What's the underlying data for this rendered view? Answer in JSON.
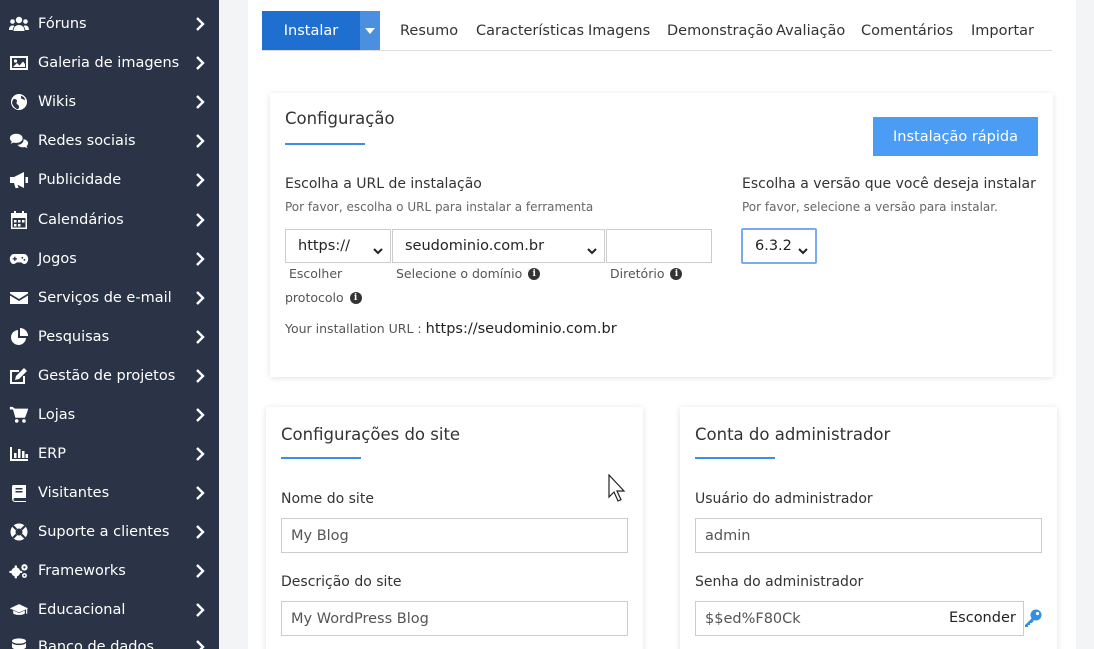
{
  "sidebar": {
    "items": [
      {
        "label": "Fóruns",
        "icon": "users-icon"
      },
      {
        "label": "Galeria de imagens",
        "icon": "image-icon"
      },
      {
        "label": "Wikis",
        "icon": "globe-icon"
      },
      {
        "label": "Redes sociais",
        "icon": "comments-icon"
      },
      {
        "label": "Publicidade",
        "icon": "megaphone-icon"
      },
      {
        "label": "Calendários",
        "icon": "calendar-icon"
      },
      {
        "label": "Jogos",
        "icon": "gamepad-icon"
      },
      {
        "label": "Serviços de e-mail",
        "icon": "envelope-icon"
      },
      {
        "label": "Pesquisas",
        "icon": "pie-chart-icon"
      },
      {
        "label": "Gestão de projetos",
        "icon": "edit-icon"
      },
      {
        "label": "Lojas",
        "icon": "cart-icon"
      },
      {
        "label": "ERP",
        "icon": "bar-chart-icon"
      },
      {
        "label": "Visitantes",
        "icon": "book-icon"
      },
      {
        "label": "Suporte a clientes",
        "icon": "lifebuoy-icon"
      },
      {
        "label": "Frameworks",
        "icon": "cogs-icon"
      },
      {
        "label": "Educacional",
        "icon": "graduation-cap-icon"
      },
      {
        "label": "Banco de dados",
        "icon": "database-icon"
      }
    ]
  },
  "tabs": {
    "install_label": "Instalar",
    "items": [
      "Resumo",
      "Características",
      "Imagens",
      "Demonstração",
      "Avaliação",
      "Comentários",
      "Importar"
    ]
  },
  "config": {
    "title": "Configuração",
    "quick_install": "Instalação rápida",
    "url_label": "Escolha a URL de instalação",
    "url_hint": "Por favor, escolha o URL para instalar a ferramenta",
    "protocol_value": "https://",
    "domain_value": "seudominio.com.br",
    "directory_value": "",
    "protocol_caption_1": "Escolher",
    "protocol_caption_2": "protocolo",
    "domain_caption": "Selecione o domínio",
    "directory_caption": "Diretório",
    "installation_url_label": "Your installation URL :",
    "installation_url_value": "https://seudominio.com.br",
    "version_label": "Escolha a versão que você deseja instalar",
    "version_hint": "Por favor, selecione a versão para instalar.",
    "version_value": "6.3.2"
  },
  "site": {
    "title": "Configurações do site",
    "name_label": "Nome do site",
    "name_value": "My Blog",
    "desc_label": "Descrição do site",
    "desc_value": "My WordPress Blog"
  },
  "admin": {
    "title": "Conta do administrador",
    "user_label": "Usuário do administrador",
    "user_value": "admin",
    "pass_label": "Senha do administrador",
    "pass_value": "$$ed%F80Ck",
    "hide_label": "Esconder"
  },
  "colors": {
    "sidebar_bg": "#2b3446",
    "primary": "#1f6fd1",
    "accent": "#4a9cf5"
  }
}
